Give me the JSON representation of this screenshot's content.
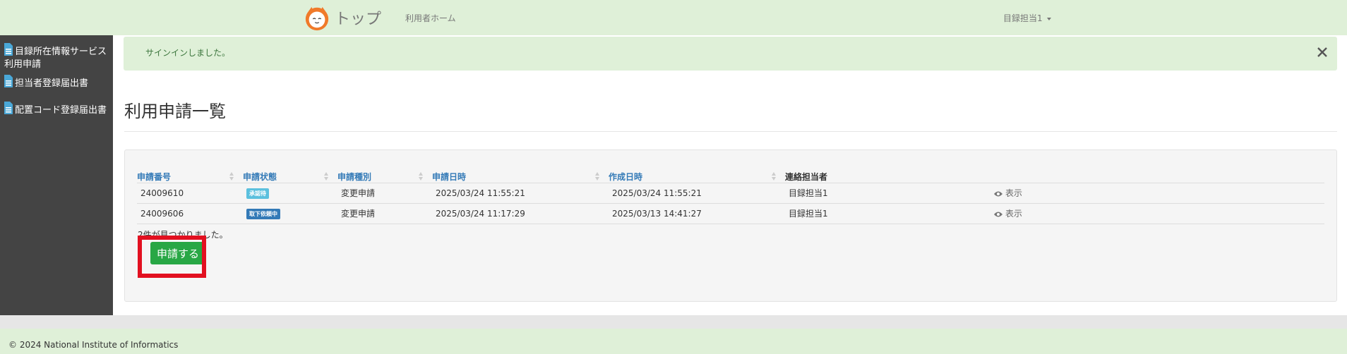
{
  "navbar": {
    "brand": "トップ",
    "home_link": "利用者ホーム",
    "user_menu": "目録担当1"
  },
  "sidebar": {
    "items": [
      {
        "line1": "目録所在情報サービス",
        "line2": "利用申請"
      },
      {
        "line1": "担当者登録届出書",
        "line2": ""
      },
      {
        "line1": "配置コード登録届出書",
        "line2": ""
      }
    ]
  },
  "alert": {
    "message": "サインインしました。"
  },
  "page": {
    "title": "利用申請一覧"
  },
  "table": {
    "headers": [
      "申請番号",
      "申請状態",
      "申請種別",
      "申請日時",
      "作成日時",
      "連絡担当者"
    ],
    "rows": [
      {
        "number": "24009610",
        "status": "承認待",
        "type": "変更申請",
        "applied": "2025/03/24 11:55:21",
        "created": "2025/03/24 11:55:21",
        "contact": "目録担当1",
        "action": "表示"
      },
      {
        "number": "24009606",
        "status": "取下依頼中",
        "type": "変更申請",
        "applied": "2025/03/24 11:17:29",
        "created": "2025/03/13 14:41:27",
        "contact": "目録担当1",
        "action": "表示"
      }
    ]
  },
  "result_text": "2件が見つかりました。",
  "apply_button": "申請する",
  "footer": {
    "copyright": "© 2024 National Institute of Informatics"
  },
  "colors": {
    "navbar": "#dff0d8",
    "sidebar": "#444444",
    "link": "#337ab7",
    "apply": "#28a745",
    "highlight": "#e21020"
  },
  "icons": {
    "logo": "cat-logo-icon",
    "doc": "document-icon",
    "close": "close-icon",
    "view": "eye-icon"
  }
}
